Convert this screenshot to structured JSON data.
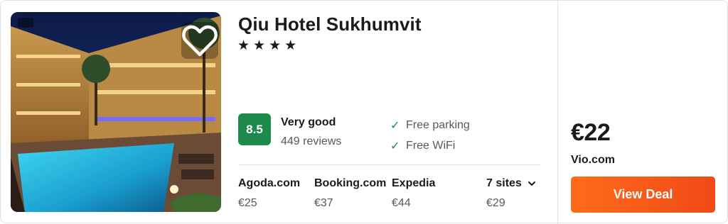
{
  "hotel": {
    "name": "Qiu Hotel Sukhumvit",
    "star_count": 4,
    "star_glyph": "★",
    "photo_icon": "hotel-photo",
    "favorite_icon": "heart-icon"
  },
  "rating": {
    "score": "8.5",
    "label": "Very good",
    "reviews": "449 reviews",
    "score_color": "#1d8a4c"
  },
  "amenities": [
    {
      "label": "Free parking",
      "icon": "check-icon",
      "glyph": "✓"
    },
    {
      "label": "Free WiFi",
      "icon": "check-icon",
      "glyph": "✓"
    }
  ],
  "sites": [
    {
      "name": "Agoda.com",
      "price": "€25"
    },
    {
      "name": "Booking.com",
      "price": "€37"
    },
    {
      "name": "Expedia",
      "price": "€44"
    }
  ],
  "more_sites": {
    "label": "7 sites",
    "price": "€29",
    "icon": "chevron-down-icon"
  },
  "deal": {
    "price": "€22",
    "provider": "Vio.com",
    "button_label": "View Deal",
    "button_color": "#ff6b1a"
  }
}
